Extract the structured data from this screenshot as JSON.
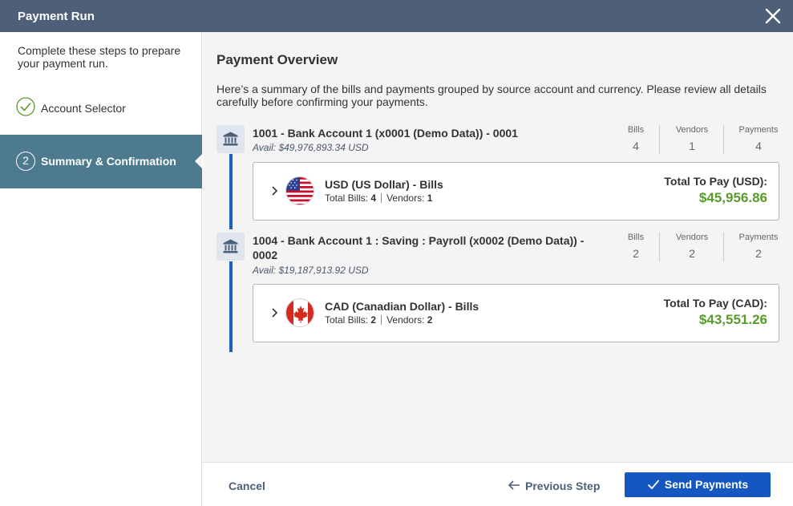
{
  "window": {
    "title": "Payment Run",
    "close_icon": "close-icon"
  },
  "sidebar": {
    "intro": "Complete these steps to prepare your payment run.",
    "steps": [
      {
        "label": "Account Selector",
        "state": "complete",
        "icon": "check-circle-icon"
      },
      {
        "number": "2",
        "label": "Summary & Confirmation",
        "state": "active"
      }
    ]
  },
  "main": {
    "title": "Payment Overview",
    "description": "Here’s a summary of the bills and payments grouped by source account and currency. Please review all details carefully before confirming your payments.",
    "accounts": [
      {
        "name": "1001 - Bank Account 1 (x0001 (Demo Data)) - 0001",
        "avail": "Avail: $49,976,893.34 USD",
        "stats": {
          "bills_label": "Bills",
          "bills": "4",
          "vendors_label": "Vendors",
          "vendors": "1",
          "payments_label": "Payments",
          "payments": "4"
        },
        "currency": {
          "name": "USD (US Dollar) - Bills",
          "total_bills_label": "Total Bills:",
          "total_bills": "4",
          "vendors_label": "Vendors:",
          "vendors": "1",
          "total_label": "Total To Pay (USD):",
          "total": "$45,956.86",
          "flag": "us-flag-icon"
        }
      },
      {
        "name": "1004 - Bank Account 1 : Saving : Payroll (x0002 (Demo Data)) - 0002",
        "avail": "Avail: $19,187,913.92 USD",
        "stats": {
          "bills_label": "Bills",
          "bills": "2",
          "vendors_label": "Vendors",
          "vendors": "2",
          "payments_label": "Payments",
          "payments": "2"
        },
        "currency": {
          "name": "CAD (Canadian Dollar) - Bills",
          "total_bills_label": "Total Bills:",
          "total_bills": "2",
          "vendors_label": "Vendors:",
          "vendors": "2",
          "total_label": "Total To Pay (CAD):",
          "total": "$43,551.26",
          "flag": "canada-flag-icon"
        }
      }
    ]
  },
  "footer": {
    "cancel": "Cancel",
    "previous": "Previous Step",
    "send": "Send Payments"
  },
  "colors": {
    "titlebar": "#4d5f79",
    "active_step": "#4d7a8e",
    "primary_button": "#1557c0",
    "total_green": "#5a9a2a",
    "timeline": "#1f5fc4"
  }
}
